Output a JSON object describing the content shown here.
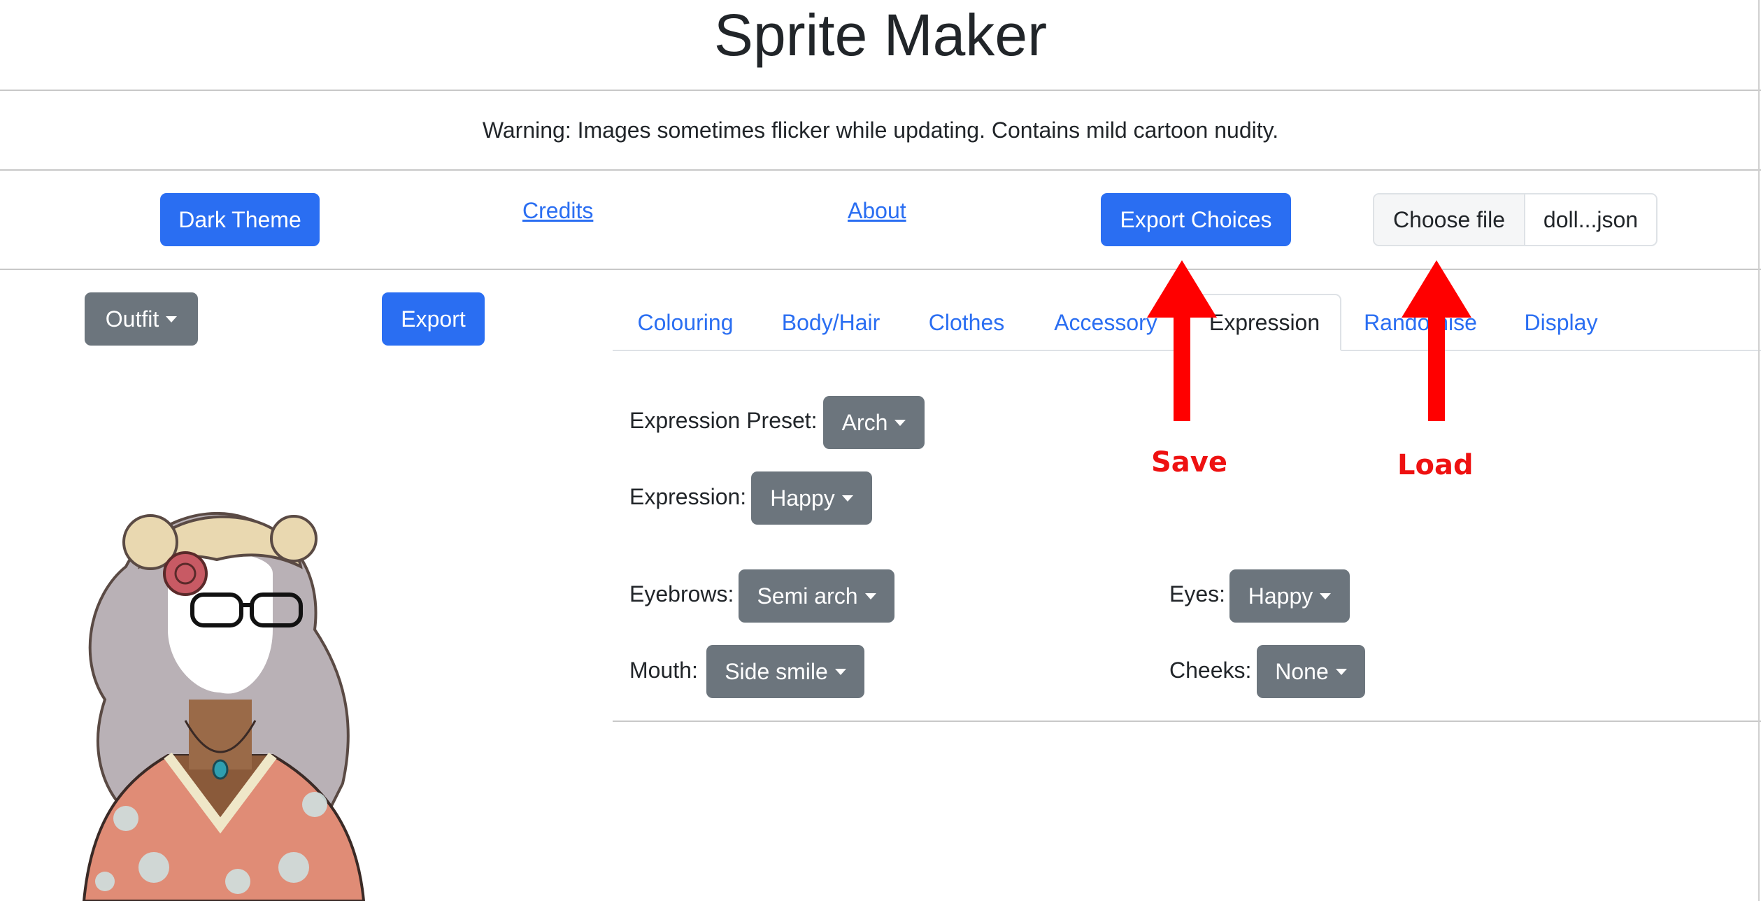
{
  "page": {
    "title": "Sprite Maker",
    "warning": "Warning: Images sometimes flicker while updating. Contains mild cartoon nudity."
  },
  "toolbar": {
    "dark_theme": "Dark Theme",
    "credits": "Credits",
    "about": "About",
    "export_choices": "Export Choices",
    "choose_file": "Choose file",
    "file_name": "doll...json"
  },
  "left_panel": {
    "outfit": "Outfit",
    "export": "Export"
  },
  "tabs": [
    {
      "label": "Colouring"
    },
    {
      "label": "Body/Hair"
    },
    {
      "label": "Clothes"
    },
    {
      "label": "Accessory"
    },
    {
      "label": "Expression",
      "active": true
    },
    {
      "label": "Randomise"
    },
    {
      "label": "Display"
    }
  ],
  "expression": {
    "preset_label": "Expression Preset:",
    "preset_value": "Arch",
    "expression_label": "Expression:",
    "expression_value": "Happy",
    "eyebrows_label": "Eyebrows:",
    "eyebrows_value": "Semi arch",
    "eyes_label": "Eyes:",
    "eyes_value": "Happy",
    "mouth_label": "Mouth:",
    "mouth_value": "Side smile",
    "cheeks_label": "Cheeks:",
    "cheeks_value": "None"
  },
  "annotations": {
    "save": "Save",
    "load": "Load",
    "arrow_color": "#ff0000"
  },
  "colors": {
    "primary": "#2a6ef2",
    "secondary": "#6c757d",
    "link": "#2a6ef2"
  }
}
